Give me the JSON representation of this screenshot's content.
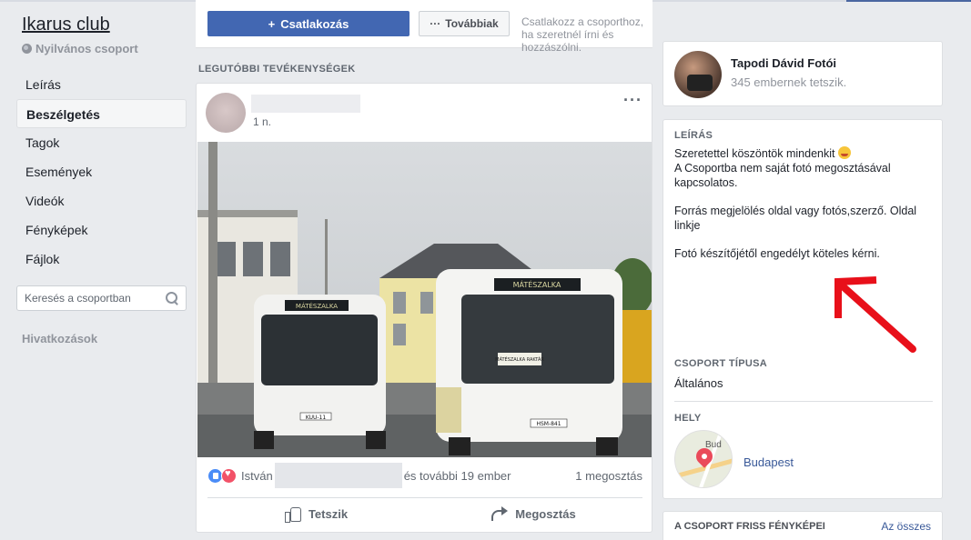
{
  "group": {
    "title": "Ikarus club",
    "privacy": "Nyilvános csoport"
  },
  "sidebar": {
    "items": [
      {
        "label": "Leírás",
        "active": false
      },
      {
        "label": "Beszélgetés",
        "active": true
      },
      {
        "label": "Tagok",
        "active": false
      },
      {
        "label": "Események",
        "active": false
      },
      {
        "label": "Videók",
        "active": false
      },
      {
        "label": "Fényképek",
        "active": false
      },
      {
        "label": "Fájlok",
        "active": false
      }
    ],
    "search_placeholder": "Keresés a csoportban",
    "links_label": "Hivatkozások"
  },
  "join_bar": {
    "join_label": "Csatlakozás",
    "more_label": "Továbbiak",
    "hint": "Csatlakozz a csoporthoz, ha szeretnél írni és hozzászólni."
  },
  "feed": {
    "section_label": "LEGUTÓBBI TEVÉKENYSÉGEK",
    "post": {
      "time": "1 n.",
      "reaction_name": "István",
      "reaction_others": "és további 19 ember",
      "share_count": "1 megosztás",
      "like_label": "Tetszik",
      "share_label": "Megosztás",
      "image_texts": {
        "bus_left_sign": "MÁTÉSZALKA",
        "bus_right_sign": "MÁTÉSZALKA",
        "bus_right_windshield_sign": "MÁTÉSZALKA RAKTÁR",
        "plate_left": "KUU-11",
        "plate_right": "HSM-841"
      }
    }
  },
  "right": {
    "profile": {
      "name": "Tapodi Dávid Fotói",
      "likes": "345 embernek tetszik."
    },
    "description": {
      "label": "LEÍRÁS",
      "line1": "Szeretettel köszöntök mindenkit",
      "line2": "A Csoportba nem saját fotó megosztásával kapcsolatos.",
      "line3": "Forrás megjelölés oldal vagy fotós,szerző. Oldal linkje",
      "line4": "Fotó készítőjétől engedélyt köteles kérni."
    },
    "group_type": {
      "label": "CSOPORT TÍPUSA",
      "value": "Általános"
    },
    "location": {
      "label": "HELY",
      "map_text": "Bud",
      "place": "Budapest"
    },
    "photos": {
      "label": "A CSOPORT FRISS FÉNYKÉPEI",
      "see_all": "Az összes"
    }
  },
  "colors": {
    "primary_blue": "#4267b2",
    "link_blue": "#385898",
    "page_bg": "#e9ebee",
    "annotation_arrow": "#e8101a"
  }
}
